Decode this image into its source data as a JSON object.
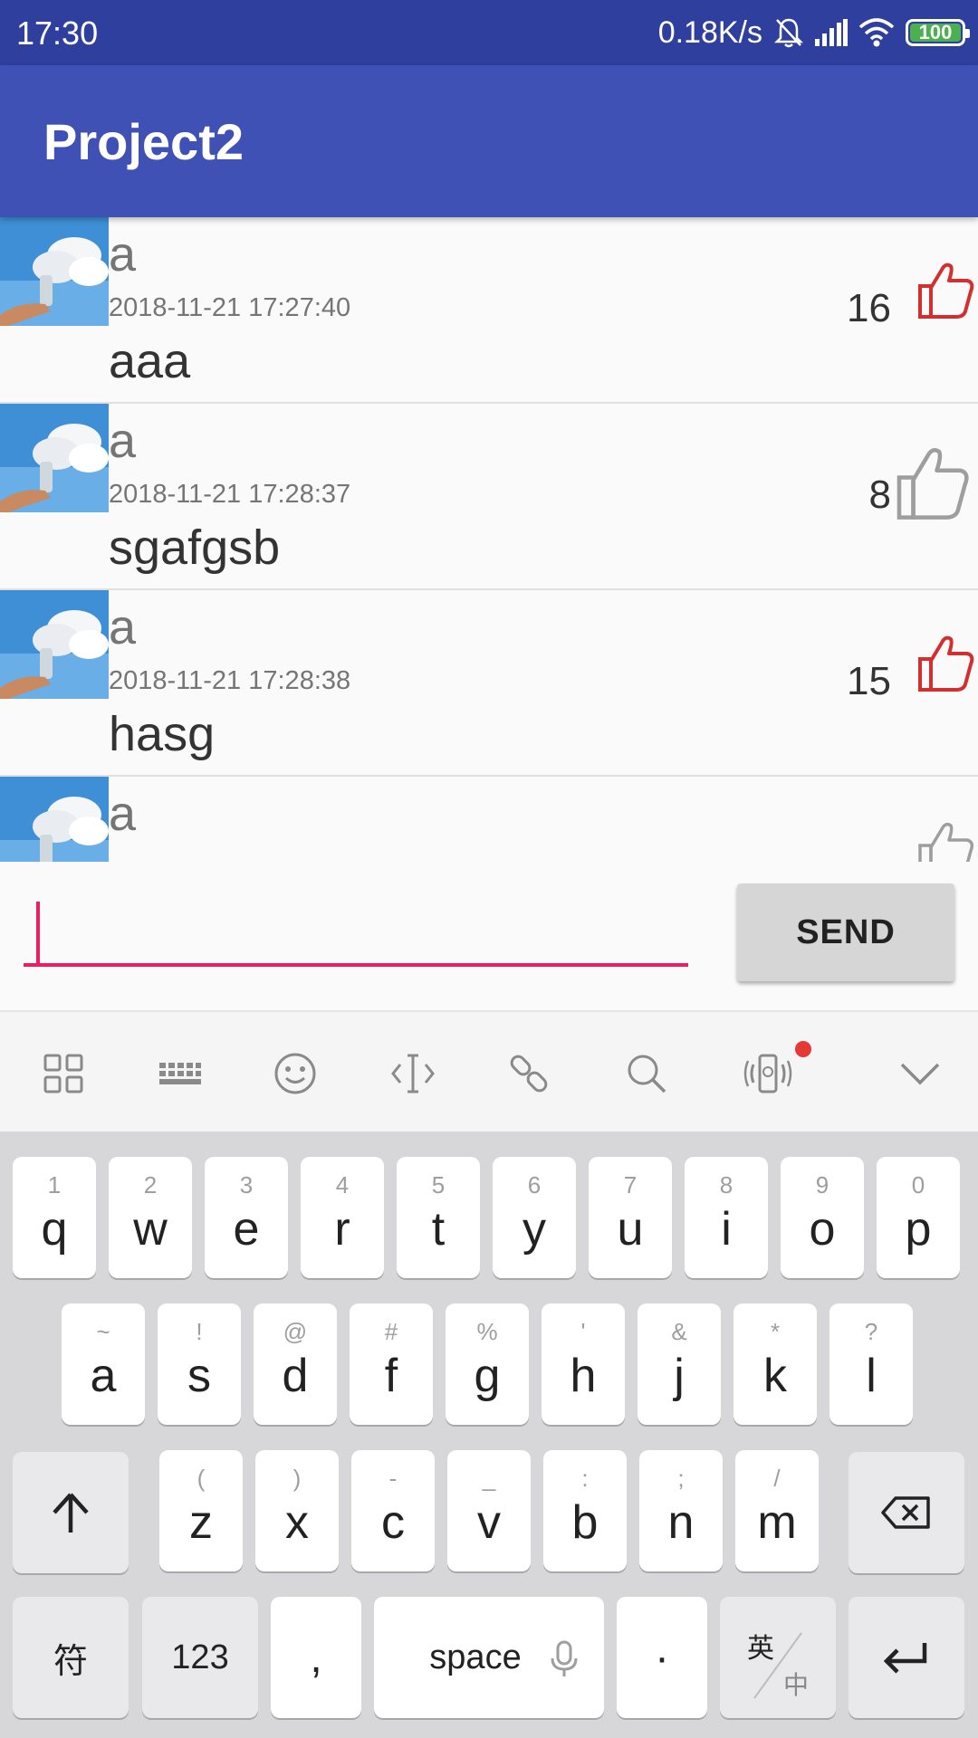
{
  "status_bar": {
    "time": "17:30",
    "net_speed": "0.18K/s",
    "battery": "100"
  },
  "app_bar": {
    "title": "Project2"
  },
  "messages": [
    {
      "user": "a",
      "time": "2018-11-21 17:27:40",
      "content": "aaa",
      "likes": "16",
      "liked": true
    },
    {
      "user": "a",
      "time": "2018-11-21 17:28:37",
      "content": "sgafgsb",
      "likes": "8",
      "liked": false
    },
    {
      "user": "a",
      "time": "2018-11-21 17:28:38",
      "content": "hasg",
      "likes": "15",
      "liked": true
    },
    {
      "user": "a",
      "time": "",
      "content": "",
      "likes": "",
      "liked": false
    }
  ],
  "composer": {
    "input_value": "",
    "send_label": "SEND"
  },
  "keyboard_toolbar": [
    "grid-icon",
    "keyboard-icon",
    "emoji-icon",
    "cursor-icon",
    "link-icon",
    "search-icon",
    "vibrate-icon",
    "collapse-icon"
  ],
  "keyboard": {
    "row1": [
      {
        "hint": "1",
        "key": "q"
      },
      {
        "hint": "2",
        "key": "w"
      },
      {
        "hint": "3",
        "key": "e"
      },
      {
        "hint": "4",
        "key": "r"
      },
      {
        "hint": "5",
        "key": "t"
      },
      {
        "hint": "6",
        "key": "y"
      },
      {
        "hint": "7",
        "key": "u"
      },
      {
        "hint": "8",
        "key": "i"
      },
      {
        "hint": "9",
        "key": "o"
      },
      {
        "hint": "0",
        "key": "p"
      }
    ],
    "row2": [
      {
        "hint": "~",
        "key": "a"
      },
      {
        "hint": "!",
        "key": "s"
      },
      {
        "hint": "@",
        "key": "d"
      },
      {
        "hint": "#",
        "key": "f"
      },
      {
        "hint": "%",
        "key": "g"
      },
      {
        "hint": "'",
        "key": "h"
      },
      {
        "hint": "&",
        "key": "j"
      },
      {
        "hint": "*",
        "key": "k"
      },
      {
        "hint": "?",
        "key": "l"
      }
    ],
    "row3": [
      {
        "hint": "(",
        "key": "z"
      },
      {
        "hint": ")",
        "key": "x"
      },
      {
        "hint": "-",
        "key": "c"
      },
      {
        "hint": "_",
        "key": "v"
      },
      {
        "hint": ":",
        "key": "b"
      },
      {
        "hint": ";",
        "key": "n"
      },
      {
        "hint": "/",
        "key": "m"
      }
    ],
    "symbols_label": "符",
    "numbers_label": "123",
    "comma_label": ",",
    "space_label": "space",
    "period_label": "·",
    "lang_top": "英",
    "lang_bottom": "中"
  },
  "colors": {
    "status_bar": "#2f3f9e",
    "app_bar": "#3f51b5",
    "accent": "#e91e63",
    "liked": "#d32f2f",
    "unliked": "#9e9e9e"
  }
}
